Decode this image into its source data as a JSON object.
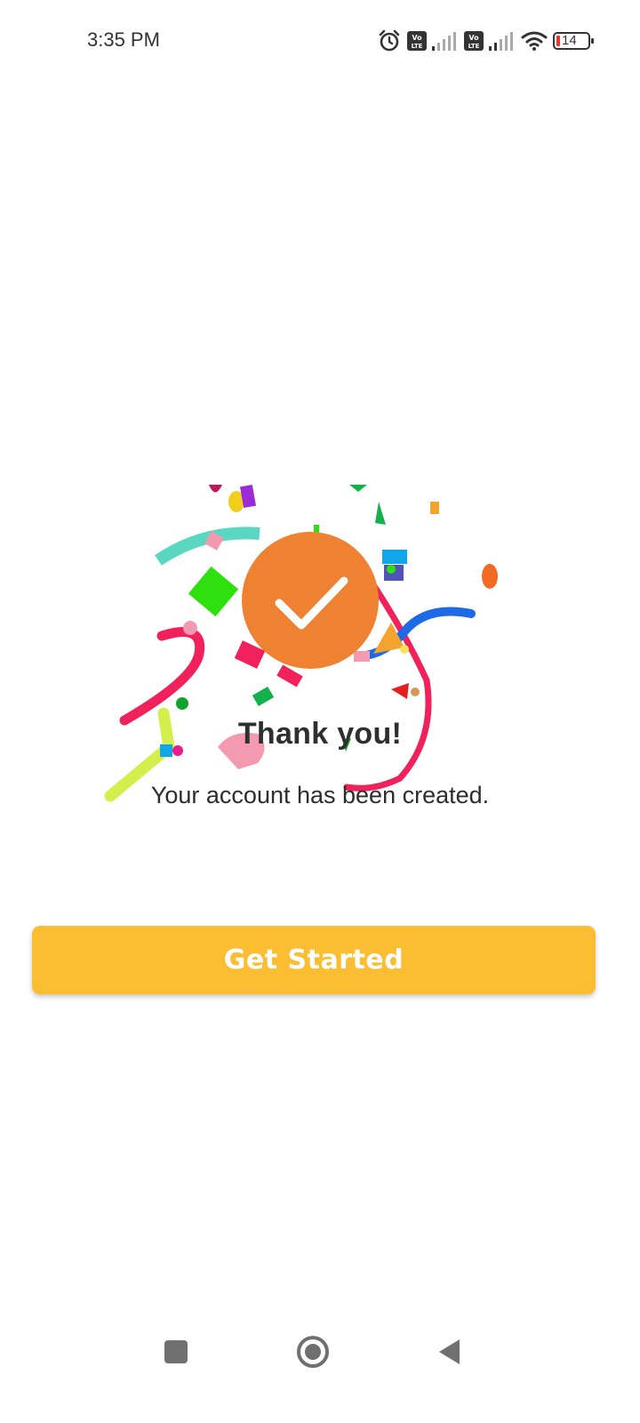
{
  "status_bar": {
    "time": "3:35 PM",
    "battery_level": "14",
    "icons": [
      "alarm-icon",
      "volte-icon",
      "signal-icon",
      "volte-icon",
      "signal-icon",
      "wifi-icon",
      "battery-icon"
    ]
  },
  "main": {
    "title": "Thank you!",
    "subtitle": "Your account has been created.",
    "cta_label": "Get Started"
  },
  "colors": {
    "badge": "#ef8133",
    "cta": "#fbbd32",
    "cta_text": "#ffffff"
  },
  "nav_bar": {
    "icons": [
      "recents-icon",
      "home-icon",
      "back-icon"
    ]
  }
}
